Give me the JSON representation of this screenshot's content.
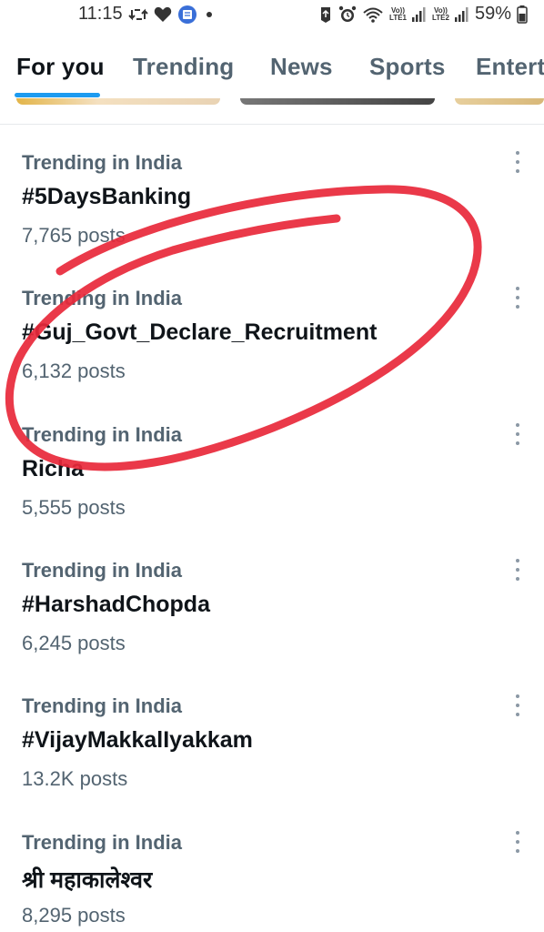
{
  "status_bar": {
    "time": "11:15",
    "battery": "59%",
    "sim1_label": "LTE1",
    "sim2_label": "LTE2",
    "volte_label": "Vo))"
  },
  "tabs": [
    {
      "label": "For you",
      "active": true
    },
    {
      "label": "Trending",
      "active": false
    },
    {
      "label": "News",
      "active": false
    },
    {
      "label": "Sports",
      "active": false
    },
    {
      "label": "Entert",
      "active": false
    }
  ],
  "trends": [
    {
      "context": "Trending in India",
      "name": "#5DaysBanking",
      "count": "7,765 posts"
    },
    {
      "context": "Trending in India",
      "name": "#Guj_Govt_Declare_Recruitment",
      "count": "6,132 posts"
    },
    {
      "context": "Trending in India",
      "name": "Richa",
      "count": "5,555 posts"
    },
    {
      "context": "Trending in India",
      "name": "#HarshadChopda",
      "count": "6,245 posts"
    },
    {
      "context": "Trending in India",
      "name": "#VijayMakkalIyakkam",
      "count": "13.2K posts"
    },
    {
      "context": "Trending in India",
      "name": "श्री महाकालेश्वर",
      "count": "8,295 posts"
    }
  ],
  "colors": {
    "accent": "#1d9bf0",
    "annotation": "#e8283a",
    "secondary_text": "#536471"
  },
  "icons": [
    "repost-icon",
    "heart-icon",
    "app-icon",
    "notification-dot-icon",
    "data-saver-icon",
    "alarm-icon",
    "wifi-icon",
    "signal-icon",
    "battery-icon",
    "more-options-icon"
  ]
}
